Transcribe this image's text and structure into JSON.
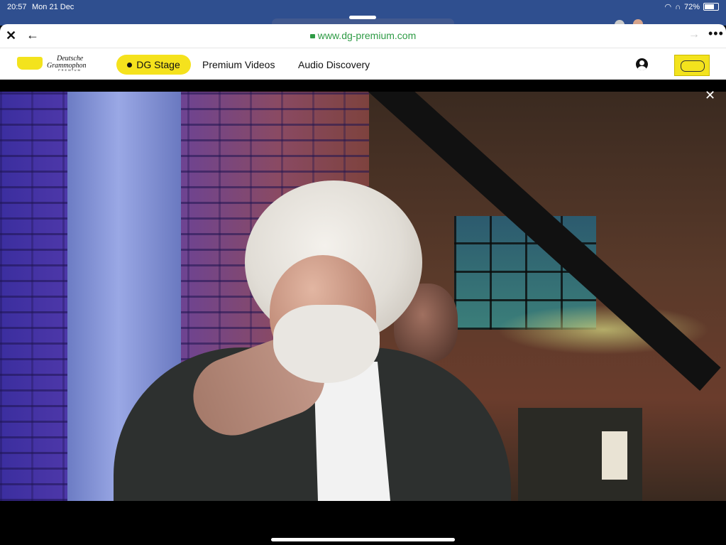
{
  "status_bar": {
    "time": "20:57",
    "date": "Mon 21 Dec",
    "battery": "72%",
    "battery_level": 0.72
  },
  "browser": {
    "url": "www.dg-premium.com"
  },
  "nav": {
    "brand_line1": "Deutsche",
    "brand_line2": "Grammophon",
    "brand_sub": "PREMIUM",
    "items": [
      {
        "label": "DG Stage",
        "active": true
      },
      {
        "label": "Premium Videos"
      },
      {
        "label": "Audio Discovery"
      }
    ]
  },
  "colors": {
    "accent_yellow": "#F5E21D",
    "url_green": "#2E9B45",
    "status_bar_blue": "#2F4F8F"
  },
  "icons": {
    "close": "close-icon",
    "back": "arrow-left-icon",
    "lock": "lock-icon",
    "forward": "arrow-right-icon",
    "more": "more-dots-icon",
    "user": "user-account-icon",
    "video_close": "close-icon"
  }
}
